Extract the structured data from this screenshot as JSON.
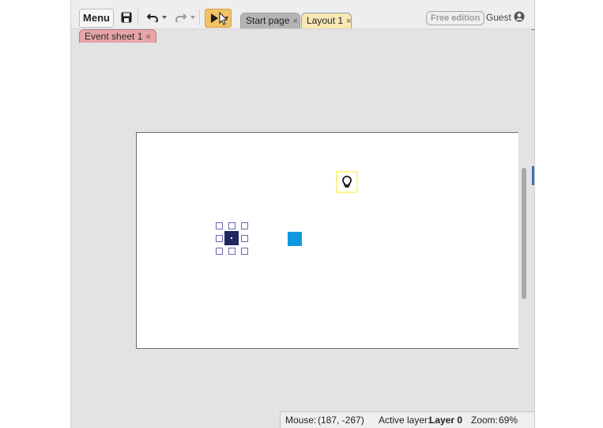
{
  "toolbar": {
    "menu_label": "Menu",
    "icons": [
      "save-icon",
      "undo-icon",
      "redo-icon",
      "play-icon"
    ]
  },
  "tabs": [
    {
      "label": "Start page",
      "active": false
    },
    {
      "label": "Layout 1",
      "active": true
    }
  ],
  "tab_close_glyph": "×",
  "edition_badge": "Free edition",
  "user": {
    "name": "Guest",
    "icon": "user-circle-icon"
  },
  "event_sheet_tab": {
    "label": "Event sheet 1"
  },
  "status_bar": {
    "mouse_label": "Mouse:",
    "mouse_value": "(187, -267)",
    "layer_label": "Active layer:",
    "layer_value": "Layer 0",
    "zoom_label": "Zoom:",
    "zoom_value": "69%"
  },
  "colors": {
    "play_button": "#f2c266",
    "active_tab": "#f8e8b4",
    "event_sheet_tab": "#e7a5a8",
    "selected_sprite": "#1e2a5e",
    "blue_sprite": "#0e99df",
    "light_object_border": "#fff58a"
  }
}
